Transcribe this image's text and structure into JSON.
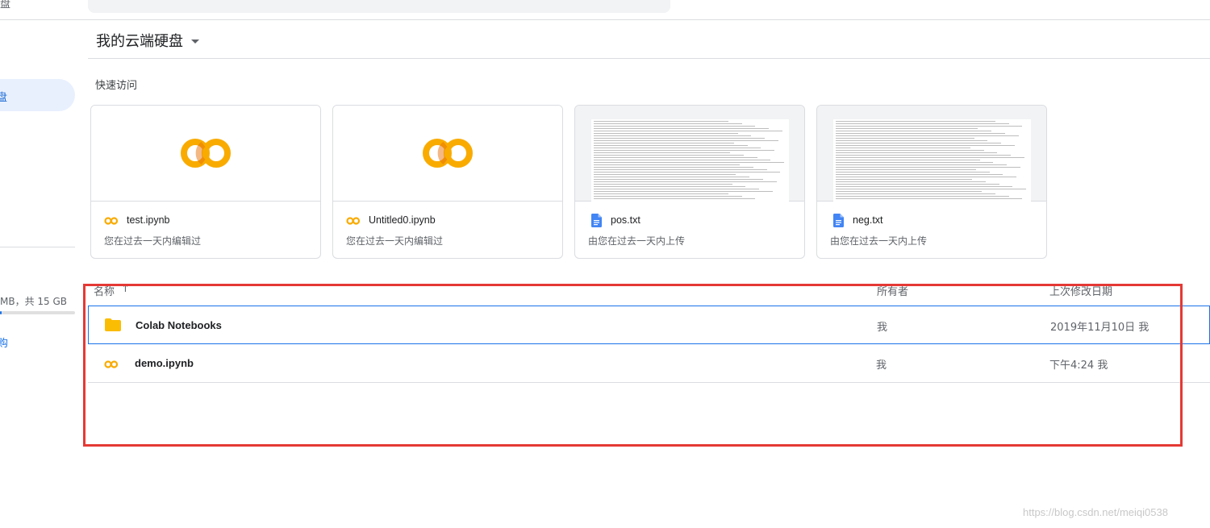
{
  "sidebar": {
    "top_clip": "盘",
    "active_clip": "盘",
    "storage_text": "MB，共 15 GB",
    "storage_fraction": 0.02,
    "buy_clip": "购"
  },
  "header": {
    "drive_title": "我的云端硬盘"
  },
  "quick_access": {
    "title": "快速访问",
    "cards": [
      {
        "name": "test.ipynb",
        "sub": "您在过去一天内编辑过",
        "type": "colab"
      },
      {
        "name": "Untitled0.ipynb",
        "sub": "您在过去一天内编辑过",
        "type": "colab"
      },
      {
        "name": "pos.txt",
        "sub": "由您在过去一天内上传",
        "type": "doc"
      },
      {
        "name": "neg.txt",
        "sub": "由您在过去一天内上传",
        "type": "doc"
      }
    ]
  },
  "file_list": {
    "columns": {
      "name": "名称",
      "sort_arrow": "↑",
      "owner": "所有者",
      "modified": "上次修改日期"
    },
    "rows": [
      {
        "name": "Colab Notebooks",
        "owner": "我",
        "modified": "2019年11月10日 我",
        "type": "folder"
      },
      {
        "name": "demo.ipynb",
        "owner": "我",
        "modified": "下午4:24 我",
        "type": "colab"
      }
    ]
  },
  "colors": {
    "accent": "#1a73e8",
    "colab_yellow": "#f9ab00",
    "folder": "#fbbc04",
    "annotation_red": "#e53935"
  },
  "icons": {
    "colab": "colab-logo-icon",
    "doc": "google-docs-icon",
    "folder": "folder-icon"
  },
  "watermark": "https://blog.csdn.net/meiqi0538"
}
